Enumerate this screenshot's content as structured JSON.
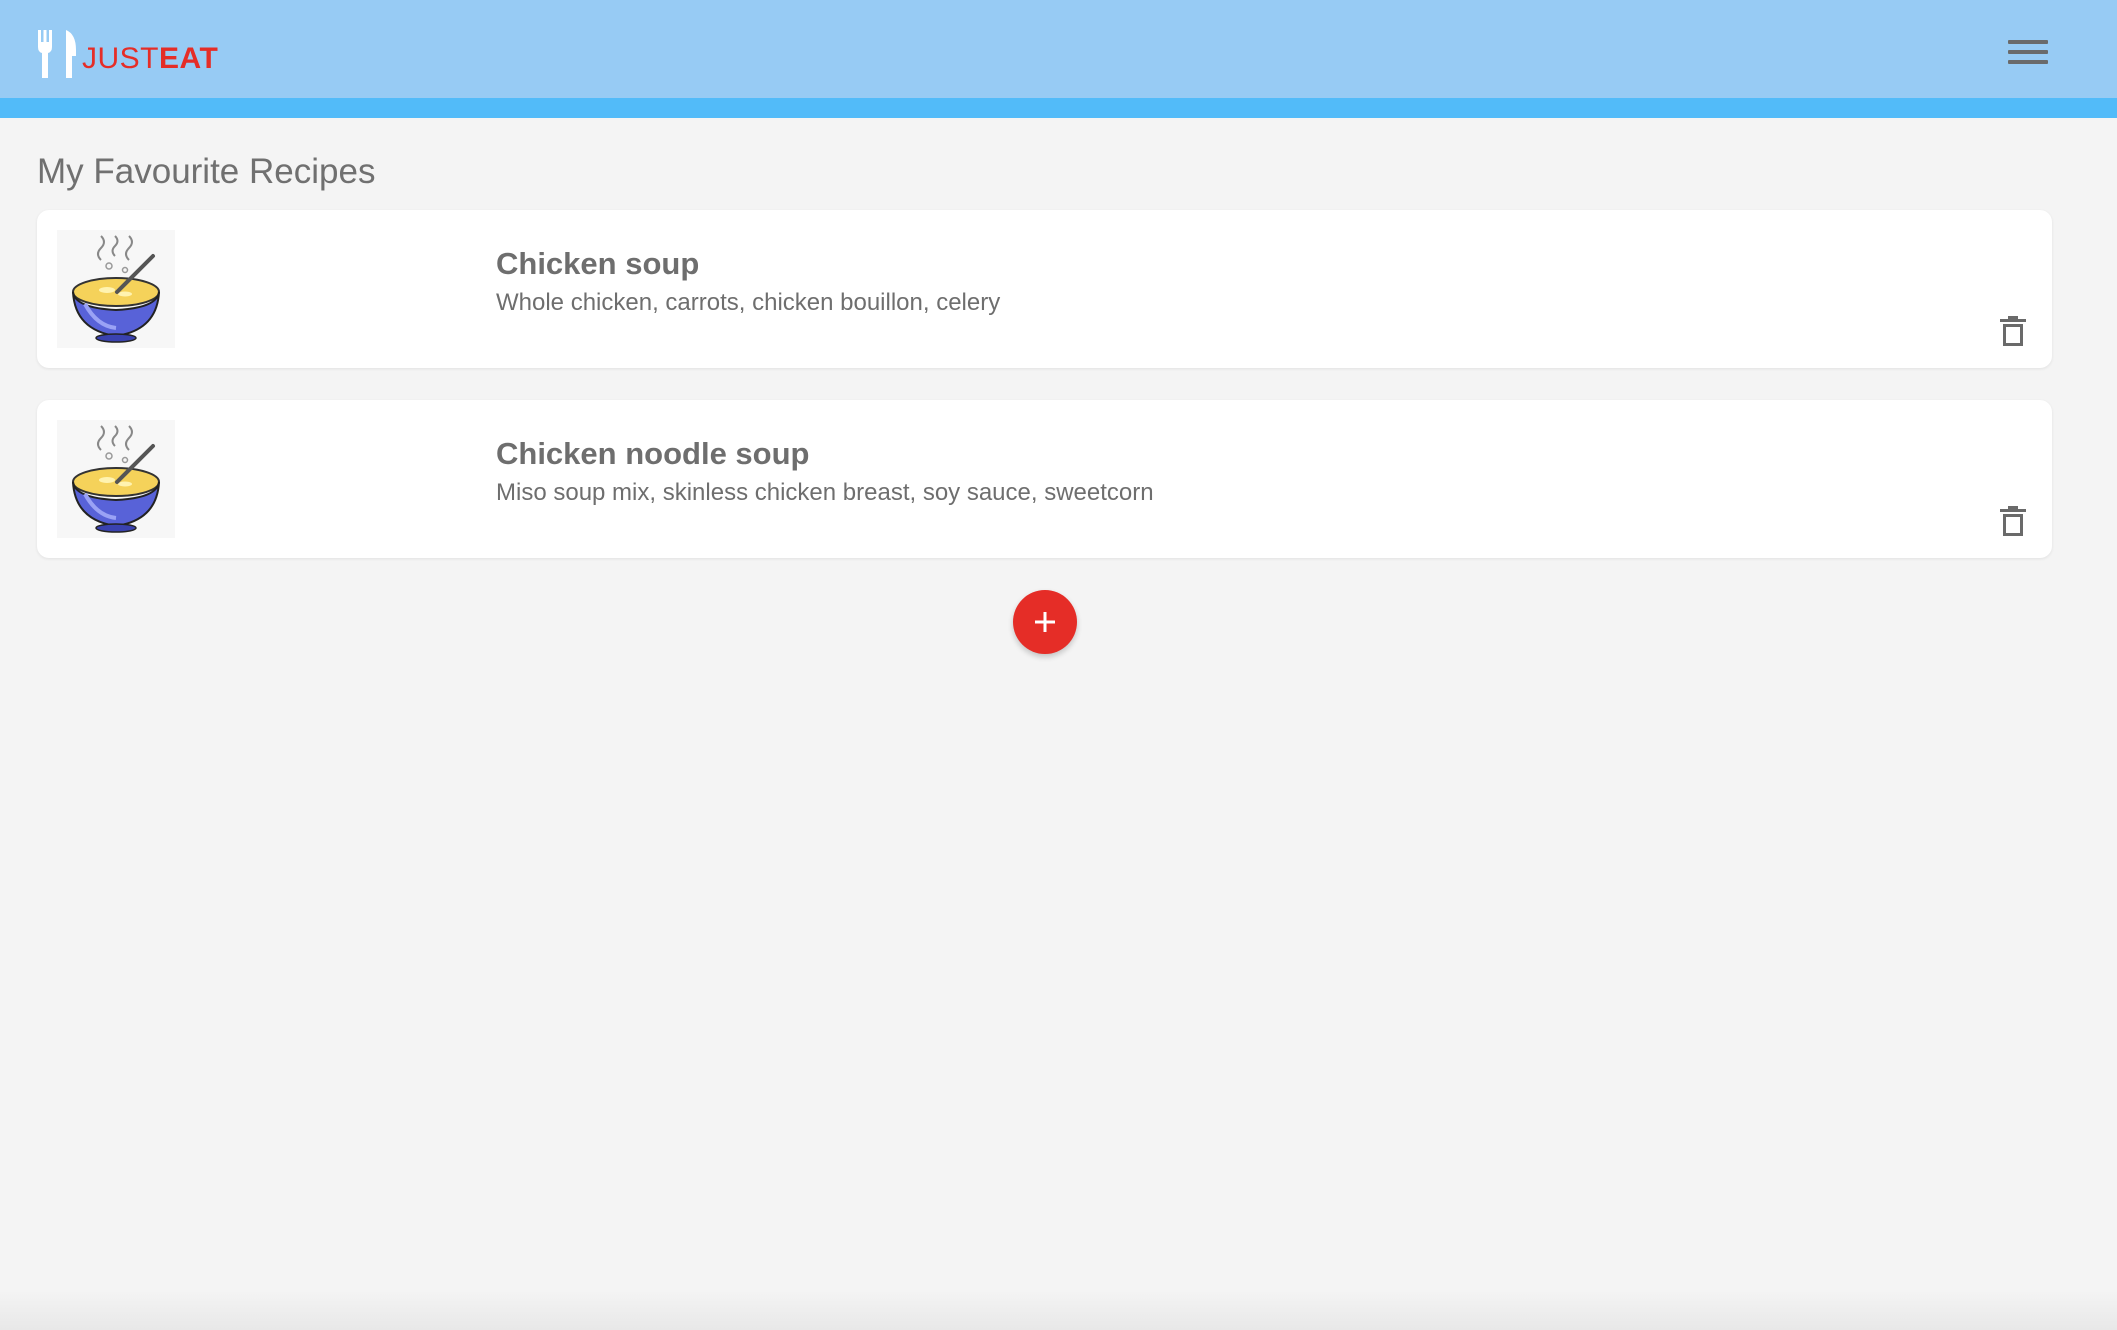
{
  "header": {
    "logo_just": "JUST",
    "logo_eat": "EAT",
    "menu_icon": "hamburger-menu-icon",
    "brand_color": "#e52d27",
    "bar_color": "#97cbf4",
    "strip_color": "#52bbf9"
  },
  "main": {
    "title": "My Favourite Recipes",
    "recipes": [
      {
        "name": "Chicken soup",
        "ingredients": "Whole chicken, carrots, chicken bouillon, celery",
        "image_icon": "soup-bowl-icon",
        "delete_icon": "trash-icon"
      },
      {
        "name": "Chicken noodle soup",
        "ingredients": "Miso soup mix, skinless chicken breast, soy sauce, sweetcorn",
        "image_icon": "soup-bowl-icon",
        "delete_icon": "trash-icon"
      }
    ],
    "add_button_icon": "plus-icon"
  }
}
